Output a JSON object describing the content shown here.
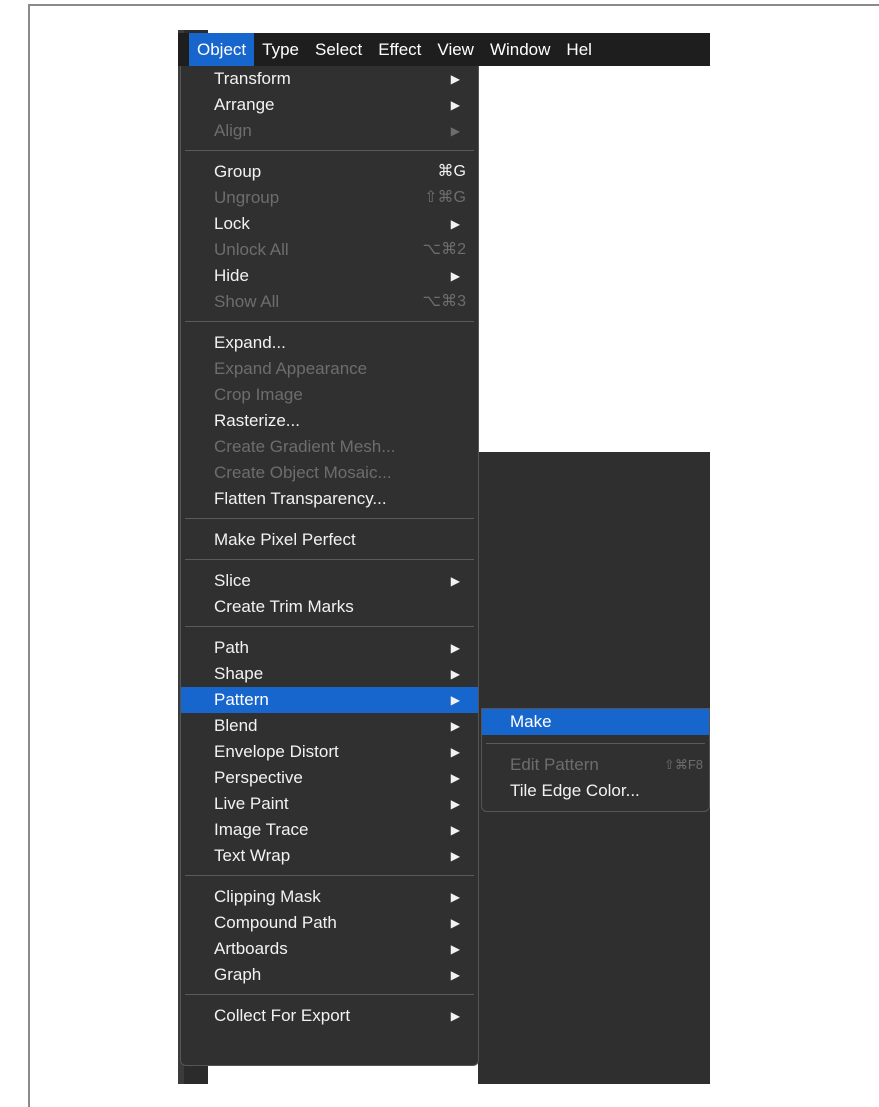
{
  "menubar": {
    "items": [
      "Object",
      "Type",
      "Select",
      "Effect",
      "View",
      "Window",
      "Hel"
    ],
    "active_index": 0
  },
  "menu": {
    "groups": [
      [
        {
          "label": "Transform",
          "submenu": true
        },
        {
          "label": "Arrange",
          "submenu": true
        },
        {
          "label": "Align",
          "submenu": true,
          "disabled": true
        }
      ],
      [
        {
          "label": "Group",
          "shortcut": "⌘G"
        },
        {
          "label": "Ungroup",
          "shortcut": "⇧⌘G",
          "disabled": true
        },
        {
          "label": "Lock",
          "submenu": true
        },
        {
          "label": "Unlock All",
          "shortcut": "⌥⌘2",
          "disabled": true
        },
        {
          "label": "Hide",
          "submenu": true
        },
        {
          "label": "Show All",
          "shortcut": "⌥⌘3",
          "disabled": true
        }
      ],
      [
        {
          "label": "Expand..."
        },
        {
          "label": "Expand Appearance",
          "disabled": true
        },
        {
          "label": "Crop Image",
          "disabled": true
        },
        {
          "label": "Rasterize..."
        },
        {
          "label": "Create Gradient Mesh...",
          "disabled": true
        },
        {
          "label": "Create Object Mosaic...",
          "disabled": true
        },
        {
          "label": "Flatten Transparency..."
        }
      ],
      [
        {
          "label": "Make Pixel Perfect"
        }
      ],
      [
        {
          "label": "Slice",
          "submenu": true
        },
        {
          "label": "Create Trim Marks"
        }
      ],
      [
        {
          "label": "Path",
          "submenu": true
        },
        {
          "label": "Shape",
          "submenu": true
        },
        {
          "label": "Pattern",
          "submenu": true,
          "highlighted": true
        },
        {
          "label": "Blend",
          "submenu": true
        },
        {
          "label": "Envelope Distort",
          "submenu": true
        },
        {
          "label": "Perspective",
          "submenu": true
        },
        {
          "label": "Live Paint",
          "submenu": true
        },
        {
          "label": "Image Trace",
          "submenu": true
        },
        {
          "label": "Text Wrap",
          "submenu": true
        }
      ],
      [
        {
          "label": "Clipping Mask",
          "submenu": true
        },
        {
          "label": "Compound Path",
          "submenu": true
        },
        {
          "label": "Artboards",
          "submenu": true
        },
        {
          "label": "Graph",
          "submenu": true
        }
      ],
      [
        {
          "label": "Collect For Export",
          "submenu": true
        }
      ]
    ]
  },
  "submenu": {
    "groups": [
      [
        {
          "label": "Make",
          "highlighted": true
        }
      ],
      [
        {
          "label": "Edit Pattern",
          "shortcut": "⇧⌘F8",
          "disabled": true
        },
        {
          "label": "Tile Edge Color..."
        }
      ]
    ]
  },
  "icons": {
    "submenu_arrow": "▶"
  },
  "colors": {
    "highlight": "#1766cd",
    "menu_bg": "#303030",
    "menubar_bg": "#1e1e1e",
    "disabled_text": "#6d6d6d"
  }
}
